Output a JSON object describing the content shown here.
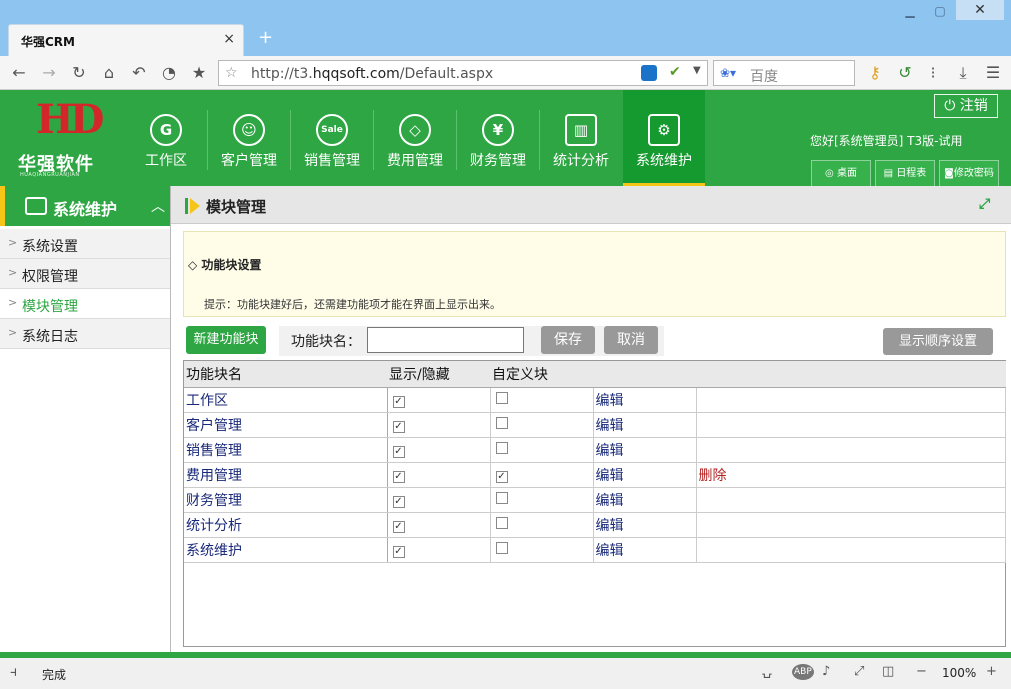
{
  "browser": {
    "tab_title": "华强CRM",
    "url_gray": "http://t3.",
    "url_domain": "hqqsoft.com",
    "url_path": "/Default.aspx",
    "search_placeholder": "百度",
    "status_text": "完成",
    "zoom": "100%"
  },
  "app": {
    "logo_letters": "HD",
    "logo_name": "华强软件",
    "logo_sub": "HUAQIANGRUANJIAN",
    "logout_label": "注销",
    "greeting": "您好[系统管理员] T3版-试用",
    "quick_buttons": [
      "桌面",
      "日程表",
      "修改密码"
    ],
    "modules": [
      {
        "label": "工作区",
        "icon": "G"
      },
      {
        "label": "客户管理",
        "icon": "☺"
      },
      {
        "label": "销售管理",
        "icon": "Sale"
      },
      {
        "label": "费用管理",
        "icon": "◇"
      },
      {
        "label": "财务管理",
        "icon": "¥"
      },
      {
        "label": "统计分析",
        "icon": "▥"
      },
      {
        "label": "系统维护",
        "icon": "⚙"
      }
    ],
    "accent": "#2ea643",
    "highlight": "#f5c518"
  },
  "sidebar": {
    "title": "系统维护",
    "items": [
      "系统设置",
      "权限管理",
      "模块管理",
      "系统日志"
    ],
    "selected": "模块管理"
  },
  "main": {
    "title": "模块管理",
    "notice_title": "◇ 功能块设置",
    "notice_desc": "提示：功能块建好后，还需建功能项才能在界面上显示出来。",
    "new_button": "新建功能块",
    "name_label": "功能块名：",
    "name_value": "",
    "save_button": "保存",
    "cancel_button": "取消",
    "order_button": "显示顺序设置",
    "columns": [
      "功能块名",
      "显示/隐藏",
      "自定义块"
    ],
    "rows": [
      {
        "name": "工作区",
        "visible": true,
        "custom": false,
        "edit": "编辑",
        "delete": ""
      },
      {
        "name": "客户管理",
        "visible": true,
        "custom": false,
        "edit": "编辑",
        "delete": ""
      },
      {
        "name": "销售管理",
        "visible": true,
        "custom": false,
        "edit": "编辑",
        "delete": ""
      },
      {
        "name": "费用管理",
        "visible": true,
        "custom": true,
        "edit": "编辑",
        "delete": "删除"
      },
      {
        "name": "财务管理",
        "visible": true,
        "custom": false,
        "edit": "编辑",
        "delete": ""
      },
      {
        "name": "统计分析",
        "visible": true,
        "custom": false,
        "edit": "编辑",
        "delete": ""
      },
      {
        "name": "系统维护",
        "visible": true,
        "custom": false,
        "edit": "编辑",
        "delete": ""
      }
    ]
  }
}
